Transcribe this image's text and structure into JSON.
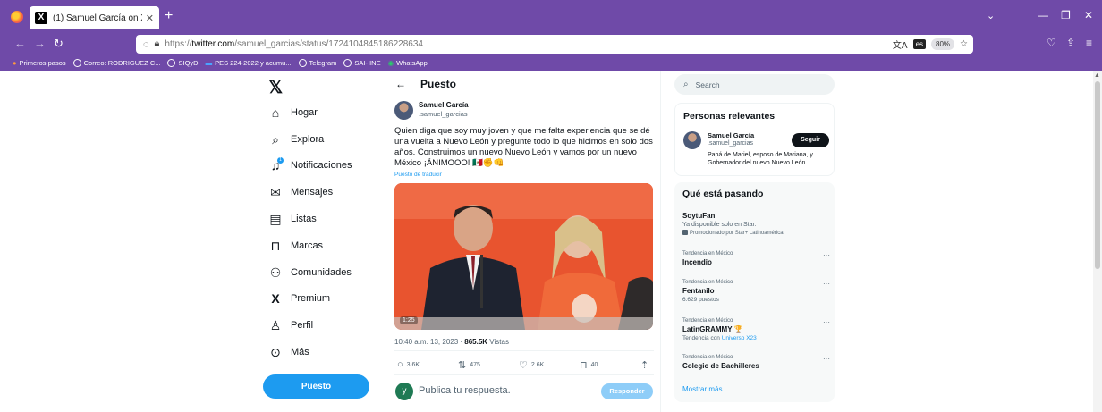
{
  "browser": {
    "tab_title": "(1) Samuel García on X: \"Quien",
    "url_prefix": "https://",
    "url_domain": "twitter.com",
    "url_path": "/samuel_garcias/status/1724104845186228634",
    "translate_lang": "es",
    "zoom": "80%"
  },
  "bookmarks": [
    "Primeros pasos",
    "Correo: RODRIGUEZ C...",
    "SIQyD",
    "PES 224-2022 y acumu...",
    "Telegram",
    "SAI- INE",
    "WhatsApp"
  ],
  "nav": {
    "items": [
      "Hogar",
      "Explora",
      "Notificaciones",
      "Mensajes",
      "Listas",
      "Marcas",
      "Comunidades",
      "Premium",
      "Perfil",
      "Más"
    ],
    "notif_count": "1",
    "post_button": "Puesto"
  },
  "post": {
    "header": "Puesto",
    "author_name": "Samuel García",
    "author_handle": ".samuel_garcias",
    "text": "Quien diga que soy muy joven y que me falta experiencia que se dé una vuelta a Nuevo León y pregunte todo lo que hicimos en solo dos años. Construimos un nuevo Nuevo León y vamos por un nuevo México ¡ÁNIMOOO! 🇲🇽✊👊",
    "translate_link": "Puesto de traducir",
    "video_duration": "1:25",
    "meta_time": "10:40 a.m. 13, 2023 · ",
    "meta_views_num": "865.5K",
    "meta_views_label": " Vistas",
    "stats": {
      "replies": "3.6K",
      "reposts": "475",
      "likes": "2.6K",
      "bookmarks": "40"
    },
    "reply_avatar_letter": "y",
    "reply_placeholder": "Publica tu respuesta.",
    "reply_button": "Responder"
  },
  "sidebar": {
    "search_placeholder": "Search",
    "relevant": {
      "title": "Personas relevantes",
      "name": "Samuel García",
      "handle": ".samuel_garcias",
      "follow": "Seguir",
      "bio": "Papá de Mariel, esposo de Mariana, y Gobernador del nuevo Nuevo León."
    },
    "trending": {
      "title": "Qué está pasando",
      "promo_name": "SoytuFan",
      "promo_sub": "Ya disponible solo en Star.",
      "promo_tag": "Promocionado por Star+ Latinoamérica",
      "items": [
        {
          "category": "Tendencia en México",
          "name": "Incendio",
          "sub": ""
        },
        {
          "category": "Tendencia en México",
          "name": "Fentanilo",
          "sub": "6.629 puestos"
        },
        {
          "category": "Tendencia en México",
          "name": "LatinGRAMMY 🏆",
          "sub_prefix": "Tendencia con ",
          "sub_link": "Universo X23"
        },
        {
          "category": "Tendencia en México",
          "name": "Colegio de Bachilleres",
          "sub": ""
        }
      ],
      "show_more": "Mostrar más"
    }
  },
  "colors": {
    "browser_chrome": "#6f4aa8",
    "accent": "#1d9bf0",
    "media_bg": "#e8542f"
  }
}
